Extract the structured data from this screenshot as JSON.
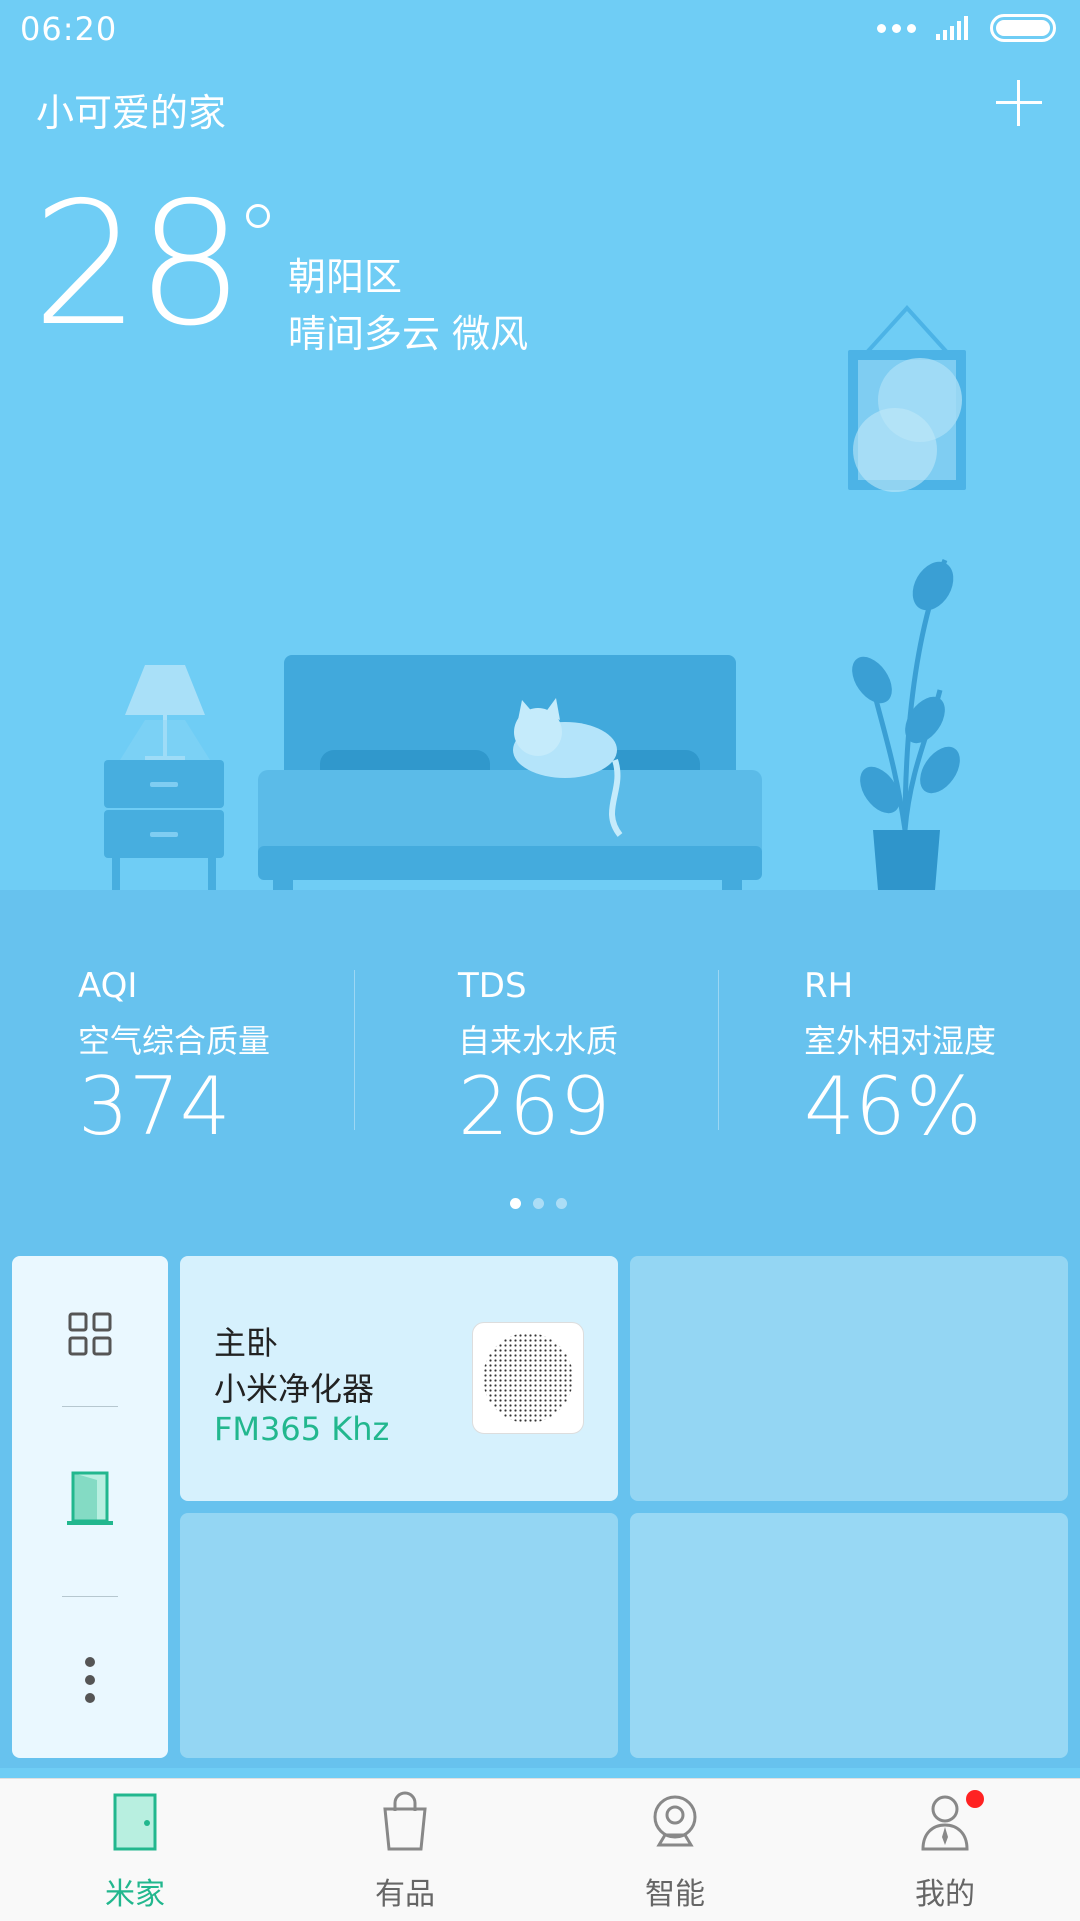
{
  "status_bar": {
    "time": "06:20"
  },
  "header": {
    "home_name": "小可爱的家"
  },
  "weather": {
    "temperature": "28",
    "district": "朝阳区",
    "condition": "晴间多云  微风"
  },
  "metrics": [
    {
      "code": "AQI",
      "label": "空气综合质量",
      "value": "374"
    },
    {
      "code": "TDS",
      "label": "自来水水质",
      "value": "269"
    },
    {
      "code": "RH",
      "label": "室外相对湿度",
      "value": "46%"
    }
  ],
  "pager": {
    "count": 3,
    "active": 0
  },
  "device_tile": {
    "room": "主卧",
    "name": "小米净化器",
    "status": "FM365 Khz"
  },
  "nav": [
    {
      "label": "米家",
      "icon": "door-icon",
      "active": true
    },
    {
      "label": "有品",
      "icon": "shopping-bag-icon"
    },
    {
      "label": "智能",
      "icon": "camera-icon"
    },
    {
      "label": "我的",
      "icon": "profile-icon"
    }
  ],
  "colors": {
    "sky": "#6fcdf5",
    "panel": "#67c2ee",
    "accent_green": "#22b78e",
    "badge_red": "#ff2222"
  }
}
